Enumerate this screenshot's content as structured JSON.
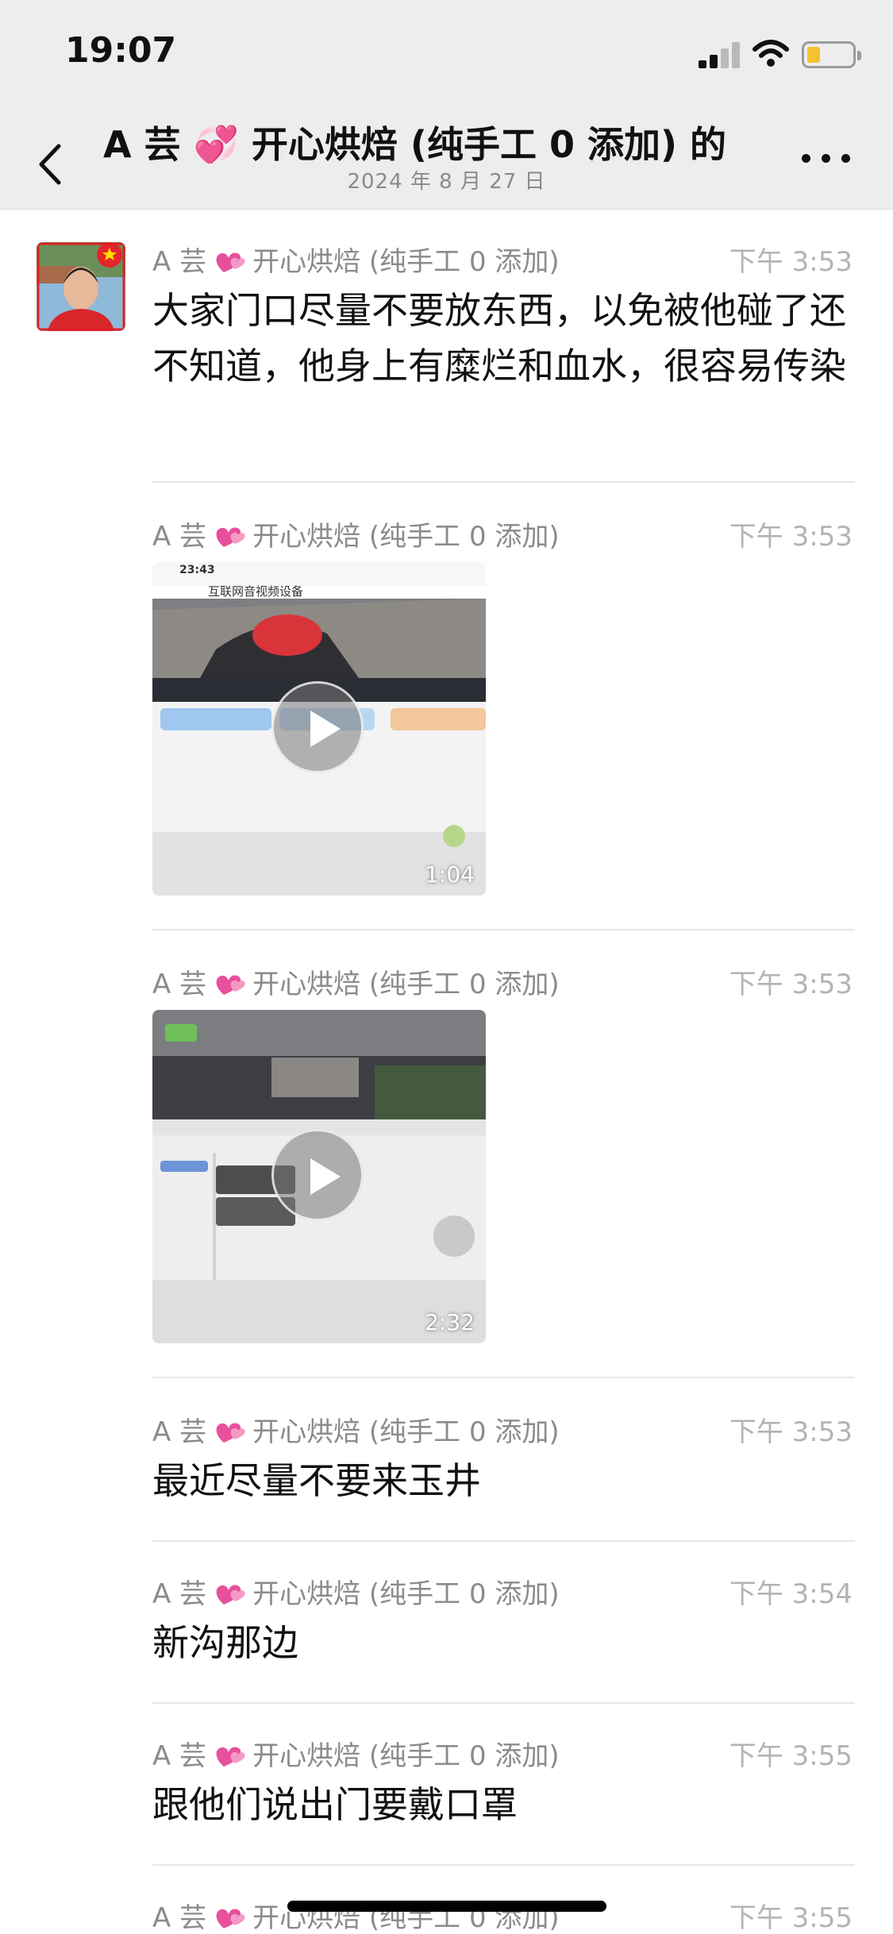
{
  "status_bar": {
    "time": "19:07",
    "battery_color": "#f2c230"
  },
  "nav": {
    "title": "A 芸 💞 开心烘焙 (纯手工 0 添加) 的",
    "subtitle": "2024 年 8 月 27 日",
    "back_icon": "chevron-left-icon",
    "more_icon": "more-dots-icon"
  },
  "sender": {
    "prefix": "A 芸",
    "icon": "heart-icon",
    "suffix": "开心烘焙 (纯手工 0 添加)"
  },
  "messages": [
    {
      "time": "下午 3:53",
      "text": "大家门口尽量不要放东西，以免被他碰了还不知道，他身上有糜烂和血水，很容易传染"
    },
    {
      "time": "下午 3:53",
      "video_duration": "1:04",
      "video_title": "互联网音视频设备",
      "video_clock": "23:43"
    },
    {
      "time": "下午 3:53",
      "video_duration": "2:32"
    },
    {
      "time": "下午 3:53",
      "text": "最近尽量不要来玉井"
    },
    {
      "time": "下午 3:54",
      "text": "新沟那边"
    },
    {
      "time": "下午 3:55",
      "text": "跟他们说出门要戴口罩"
    },
    {
      "time": "下午 3:55"
    }
  ]
}
